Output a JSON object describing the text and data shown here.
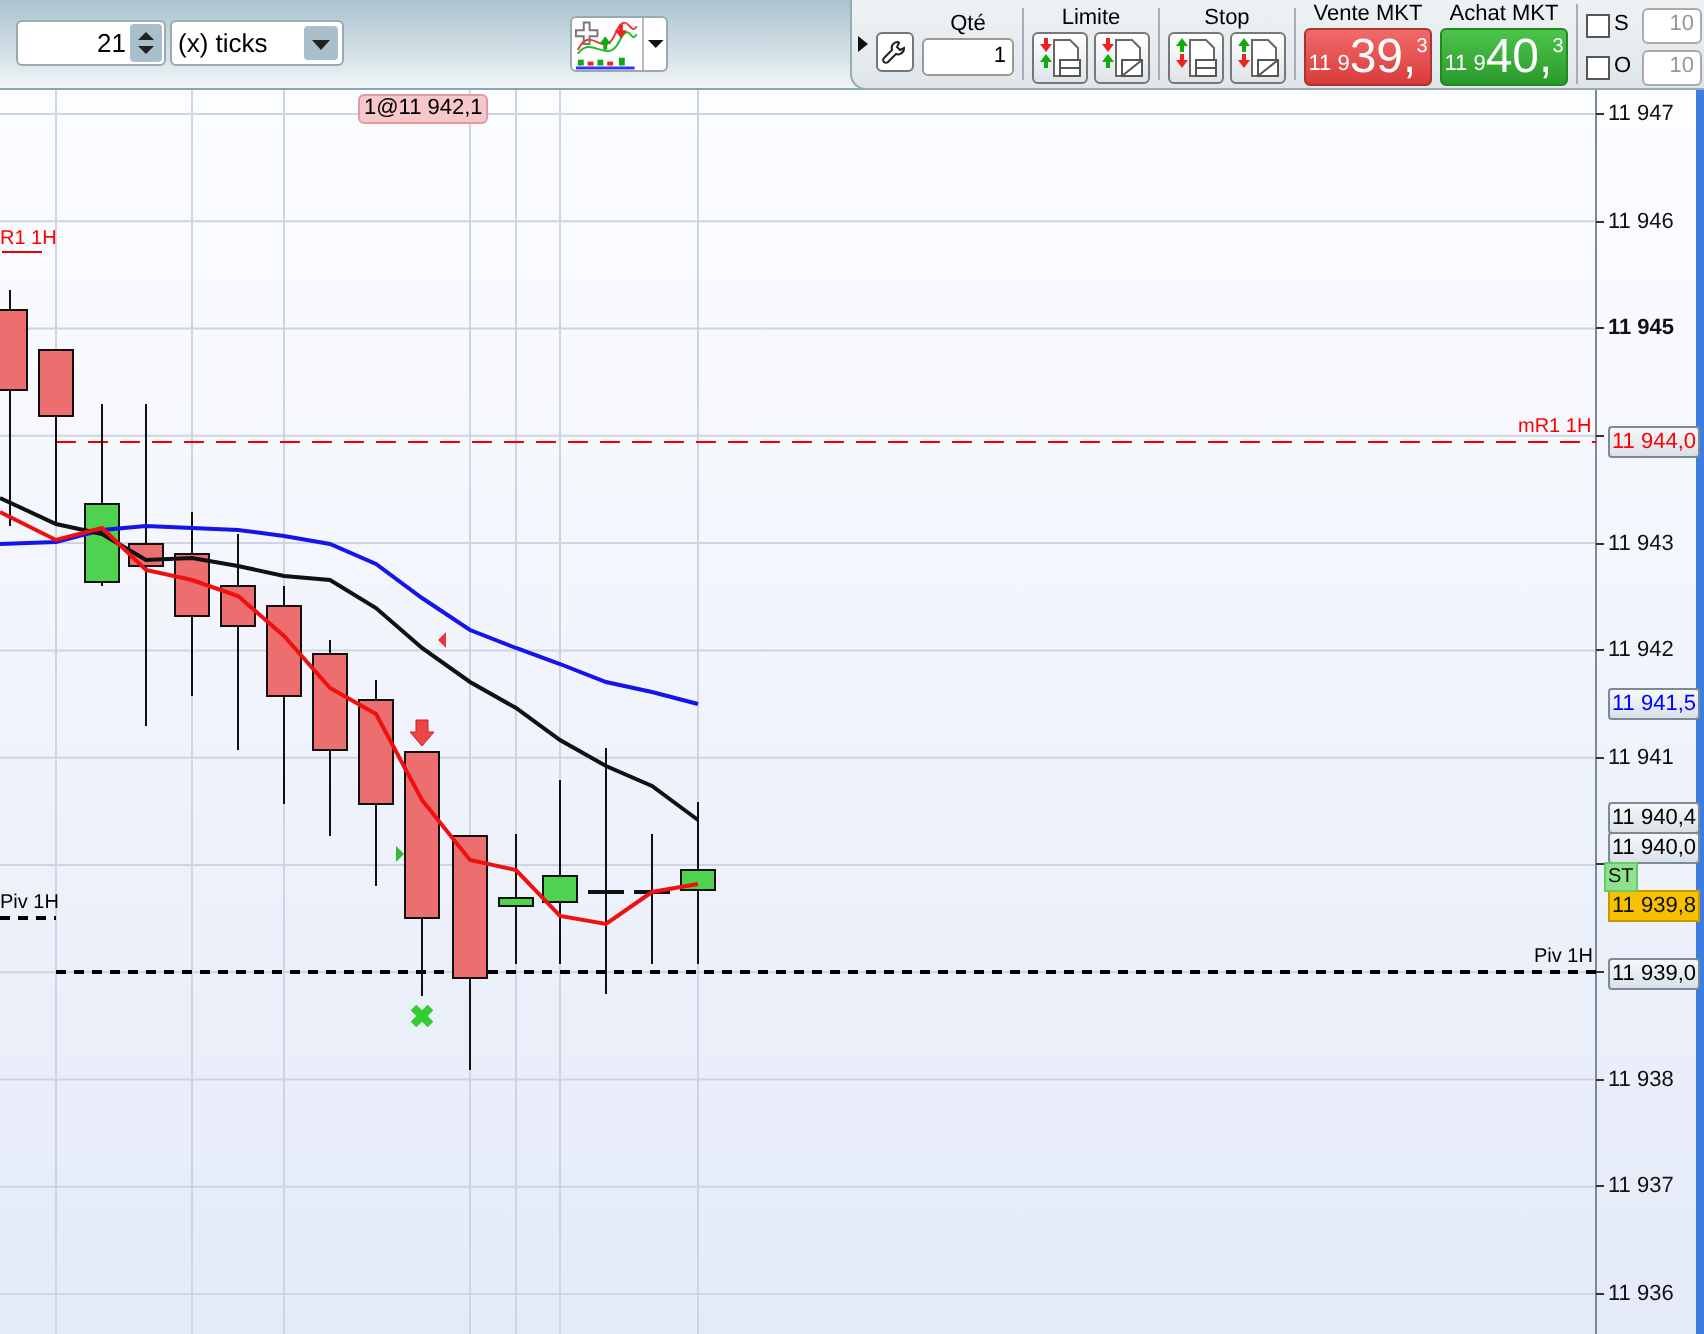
{
  "toolbar": {
    "period_spinner": {
      "value": "21"
    },
    "period_unit": {
      "value": "(x) ticks"
    }
  },
  "order_panel": {
    "quantity": {
      "label": "Qté",
      "value": "1"
    },
    "limit": {
      "label": "Limite"
    },
    "stop": {
      "label": "Stop"
    },
    "sell": {
      "label": "Vente MKT",
      "prefix": "11 9",
      "main": "39,",
      "decimal": "3"
    },
    "buy": {
      "label": "Achat MKT",
      "prefix": "11 9",
      "main": "40,",
      "decimal": "3"
    },
    "options": [
      {
        "label": "S",
        "checked": false,
        "placeholder": "10"
      },
      {
        "label": "O",
        "checked": false,
        "placeholder": "10"
      }
    ]
  },
  "chart": {
    "trade_badge": "1@11 942,1",
    "line_labels": [
      {
        "text": "R1 1H",
        "color": "#ff0000"
      },
      {
        "text": "mR1 1H",
        "color": "#ff0000"
      },
      {
        "text": "Piv 1H",
        "color": "#000000"
      },
      {
        "text": "Piv 1H",
        "color": "#000000"
      }
    ],
    "price_axis": [
      {
        "text": "11 947",
        "kind": "tick"
      },
      {
        "text": "11 946",
        "kind": "tick"
      },
      {
        "text": "11 945",
        "kind": "bold"
      },
      {
        "text": "11 944,0",
        "kind": "box",
        "color": "#ff0000"
      },
      {
        "text": "11 943",
        "kind": "tick"
      },
      {
        "text": "11 942",
        "kind": "tick"
      },
      {
        "text": "11 941,5",
        "kind": "box",
        "color": "#0000ff"
      },
      {
        "text": "11 941",
        "kind": "tick"
      },
      {
        "text": "11 940,4",
        "kind": "box",
        "color": "#000000"
      },
      {
        "text": "11 940,0",
        "kind": "box",
        "color": "#000000"
      },
      {
        "text": "11 939,8",
        "kind": "highlight"
      },
      {
        "text": "11 939,0",
        "kind": "box",
        "color": "#000000"
      },
      {
        "text": "11 938",
        "kind": "tick"
      },
      {
        "text": "11 937",
        "kind": "tick"
      },
      {
        "text": "11 936",
        "kind": "tick"
      }
    ],
    "strategy_badge": "ST"
  }
}
